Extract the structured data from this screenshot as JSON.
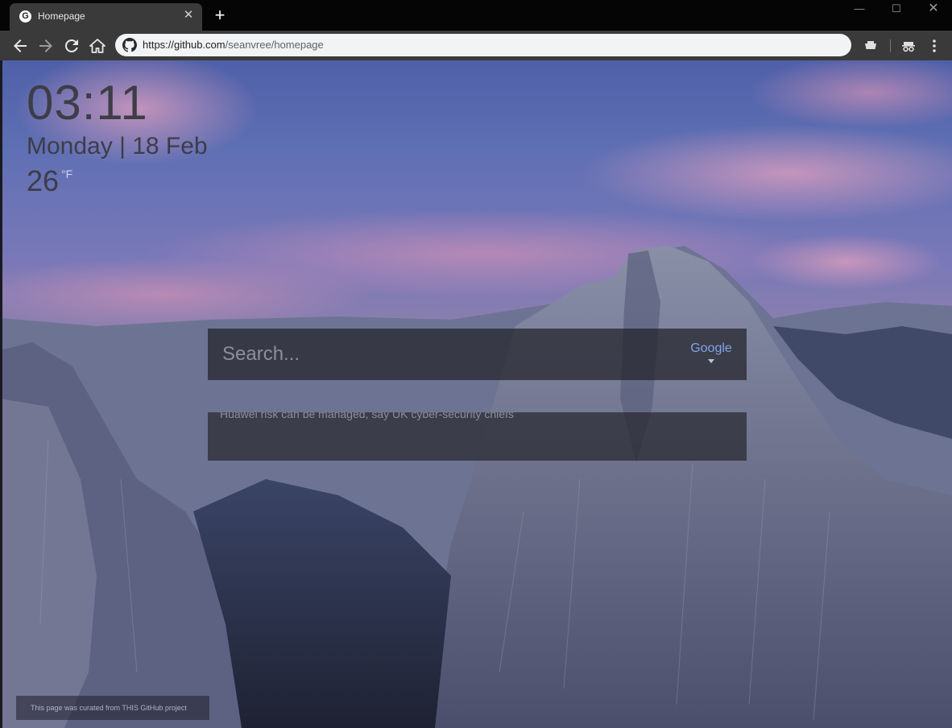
{
  "browser": {
    "tab": {
      "title": "Homepage",
      "favicon": "google-g-icon",
      "favicon_letter": "G"
    },
    "new_tab_icon": "plus-icon",
    "window_controls": [
      "minimize-icon",
      "maximize-icon",
      "close-icon"
    ],
    "address_bar": {
      "url_host": "https://github.com",
      "url_path": "/seanvree/homepage",
      "site_icon": "github-icon"
    },
    "toolbar_icons": [
      "back-icon",
      "forward-icon",
      "reload-icon",
      "home-icon",
      "extension-icon",
      "incognito-icon",
      "menu-icon"
    ]
  },
  "page": {
    "clock": "03:11",
    "date": "Monday | 18 Feb",
    "weather": {
      "temperature": "26",
      "unit": "°F",
      "icon": "moon-icon"
    },
    "search": {
      "placeholder": "Search...",
      "engine": "Google"
    },
    "news": {
      "headline": "Huawei risk can be managed, say UK cyber-security chiefs"
    },
    "footer": "This page was curated from THIS GitHub project"
  }
}
